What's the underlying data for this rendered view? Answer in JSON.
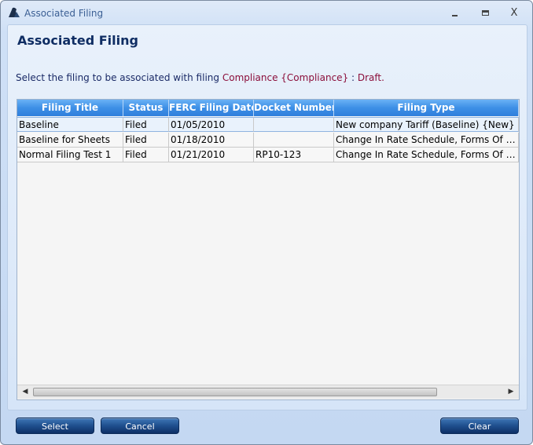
{
  "window": {
    "title": "Associated Filing",
    "minimize_label": "",
    "close_label": "X"
  },
  "main": {
    "heading": "Associated Filing",
    "instruction_prefix": "Select the filing to be associated with filing",
    "instruction_filing": "Compliance {Compliance}",
    "instruction_sep": " : ",
    "instruction_status": "Draft."
  },
  "grid": {
    "columns": [
      "Filing Title",
      "Status",
      "FERC Filing Date",
      "Docket Number",
      "Filing Type"
    ],
    "rows": [
      [
        "Baseline",
        "Filed",
        "01/05/2010",
        "",
        "New company Tariff (Baseline) {New}"
      ],
      [
        "Baseline for Sheets",
        "Filed",
        "01/18/2010",
        "",
        "Change In Rate Schedule, Forms Of Servi..."
      ],
      [
        "Normal Filing Test 1",
        "Filed",
        "01/21/2010",
        "RP10-123",
        "Change In Rate Schedule, Forms Of Servi..."
      ]
    ],
    "selected_row": 0
  },
  "buttons": {
    "select": "Select",
    "cancel": "Cancel",
    "clear": "Clear"
  },
  "icons": {
    "app": "fin-icon",
    "scroll_left": "scroll-left-arrow-icon",
    "scroll_right": "scroll-right-arrow-icon"
  },
  "colors": {
    "header": "#3d8fe6",
    "heading": "#0f2d63",
    "highlight": "#8b0e3a",
    "button": "#1f4f8e"
  }
}
